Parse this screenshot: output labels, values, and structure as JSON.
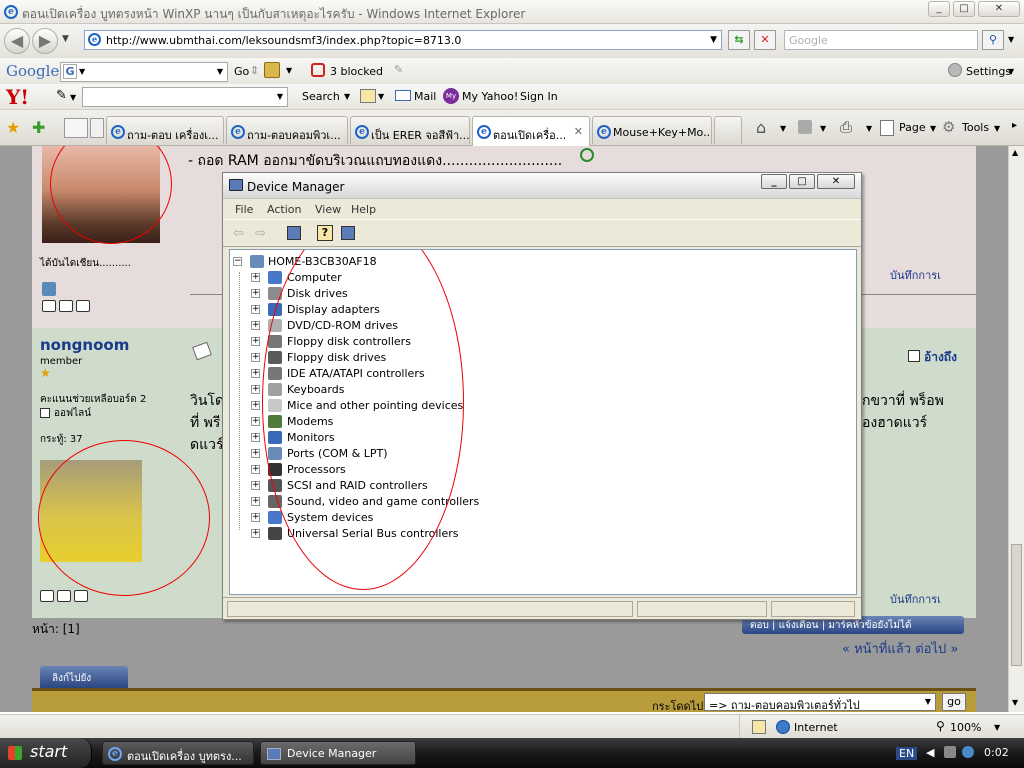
{
  "window": {
    "title": "ตอนเปิดเครื่อง บูทตรงหน้า WinXP นานๆ เป็นกับสาเหตุอะไรครับ - Windows Internet Explorer",
    "minimize": "_",
    "maximize": "□",
    "close": "✕"
  },
  "address": {
    "url": "http://www.ubmthai.com/leksoundsmf3/index.php?topic=8713.0",
    "search_placeholder": "Google"
  },
  "google_bar": {
    "logo": "Google",
    "letter": "G",
    "go_label": "Go",
    "blocked": "3 blocked",
    "settings": "Settings"
  },
  "yahoo_bar": {
    "logo": "Y!",
    "search": "Search",
    "mail": "Mail",
    "my_yahoo": "My Yahoo!",
    "sign_in": "Sign In"
  },
  "tabs": [
    {
      "label": "ถาม-ตอบ เครื่องเ..."
    },
    {
      "label": "ถาม-ตอบคอมพิวเ..."
    },
    {
      "label": "เป็น ERER จอสีฟ้า..."
    },
    {
      "label": "ตอนเปิดเครื่อ..."
    },
    {
      "label": "Mouse+Key+Mo..."
    }
  ],
  "command_bar": {
    "page": "Page",
    "tools": "Tools"
  },
  "forum": {
    "ram_text": "- ถอด RAM ออกมาขัดบริเวณแถบทองแดง...........................",
    "first_caption": "ได้บันไดเชียน..........",
    "save_label": "บันทึกการเ",
    "member_name": "nongnoom",
    "member_rank": "member",
    "help_points": "คะแนนช่วยเหลือบอร์ด 2",
    "status": "ออฟไลน์",
    "posts": "กระทู้: 37",
    "quote": "อ้างถึง",
    "post_line1_left": "วินโด",
    "post_line1_right": "กขวาที่ พร็อพ",
    "post_line2_left": "ที่ พรี",
    "post_line2_right": "องฮาดแวร์",
    "post_line3_left": "ดแวร์",
    "save_label2": "บันทึกการเ",
    "pages": "หน้า: [1]",
    "reply_btns": "ตอบ | แจ้งเตือน | มาร์คหัวข้อยังไม่ได้",
    "prev_next": "« หน้าที่แล้ว ต่อไป »",
    "jump_tab": "ลิงก์ไปยัง",
    "jump_label": "กระโดดไป",
    "jump_select": "=> ถาม-ตอบคอมพิวเตอร์ทั่วไป",
    "go": "go"
  },
  "device_manager": {
    "title": "Device Manager",
    "menu": [
      "File",
      "Action",
      "View",
      "Help"
    ],
    "root": "HOME-B3CB30AF18",
    "items": [
      {
        "label": "Computer",
        "color": "#4a78c8"
      },
      {
        "label": "Disk drives",
        "color": "#8c8c8c"
      },
      {
        "label": "Display adapters",
        "color": "#3a6ab8"
      },
      {
        "label": "DVD/CD-ROM drives",
        "color": "#b0b0b0"
      },
      {
        "label": "Floppy disk controllers",
        "color": "#777777"
      },
      {
        "label": "Floppy disk drives",
        "color": "#5a5a5a"
      },
      {
        "label": "IDE ATA/ATAPI controllers",
        "color": "#777777"
      },
      {
        "label": "Keyboards",
        "color": "#a0a0a0"
      },
      {
        "label": "Mice and other pointing devices",
        "color": "#c8c8c8"
      },
      {
        "label": "Modems",
        "color": "#4f7a3a"
      },
      {
        "label": "Monitors",
        "color": "#3a6ab8"
      },
      {
        "label": "Ports (COM & LPT)",
        "color": "#6a8ab8"
      },
      {
        "label": "Processors",
        "color": "#333333"
      },
      {
        "label": "SCSI and RAID controllers",
        "color": "#555555"
      },
      {
        "label": "Sound, video and game controllers",
        "color": "#666666"
      },
      {
        "label": "System devices",
        "color": "#4a78c8"
      },
      {
        "label": "Universal Serial Bus controllers",
        "color": "#444444"
      }
    ]
  },
  "status": {
    "zone": "Internet",
    "zoom": "100%"
  },
  "taskbar": {
    "start": "start",
    "items": [
      "ตอนเปิดเครื่อง บูทตรง...",
      "Device Manager"
    ],
    "lang": "EN",
    "clock": "0:02"
  }
}
